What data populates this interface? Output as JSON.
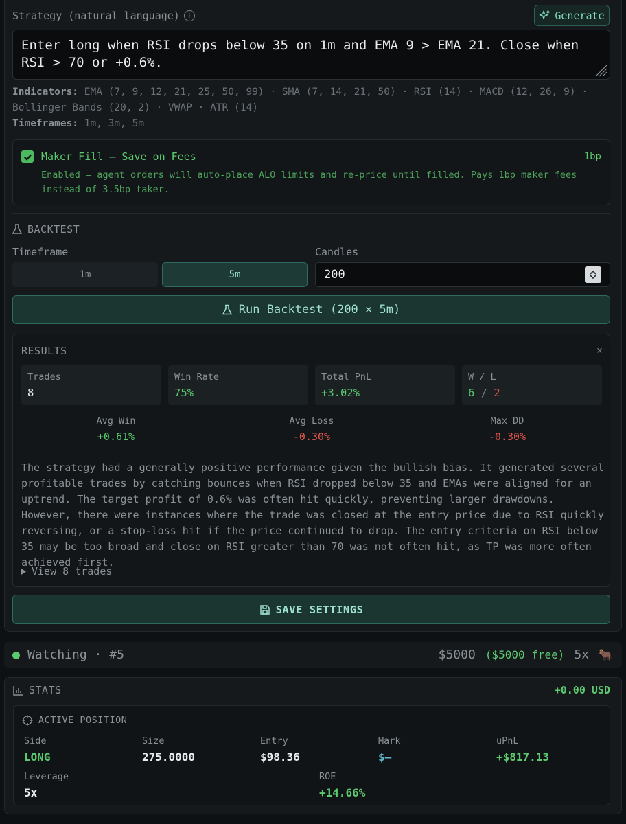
{
  "strategy": {
    "label": "Strategy (natural language)",
    "generate_label": "Generate",
    "text": "Enter long when RSI drops below 35 on 1m and EMA 9 > EMA 21. Close when RSI > 70 or +0.6%."
  },
  "indicators": {
    "label": "Indicators:",
    "line1": "EMA (7, 9, 12, 21, 25, 50, 99) · SMA (7, 14, 21, 50) · RSI (14) · MACD (12, 26, 9) ·",
    "line2": "Bollinger Bands (20, 2) · VWAP · ATR (14)",
    "timeframes_label": "Timeframes:",
    "timeframes": "1m, 3m, 5m"
  },
  "maker_fill": {
    "checked": true,
    "title": "Maker Fill — Save on Fees",
    "badge": "1bp",
    "description": "Enabled — agent orders will auto-place ALO limits and re-price until filled. Pays 1bp maker fees instead of 3.5bp taker."
  },
  "backtest": {
    "title": "BACKTEST",
    "timeframe_label": "Timeframe",
    "timeframe_options": [
      "1m",
      "5m"
    ],
    "selected_timeframe": "5m",
    "candles_label": "Candles",
    "candles_value": "200",
    "run_label": "Run Backtest (200 × 5m)"
  },
  "results": {
    "title": "RESULTS",
    "close": "×",
    "cards": [
      {
        "label": "Trades",
        "value": "8"
      },
      {
        "label": "Win Rate",
        "value": "75%"
      },
      {
        "label": "Total PnL",
        "value": "+3.02%"
      },
      {
        "label": "W / L",
        "wins": "6",
        "sep": "/",
        "losses": "2"
      }
    ],
    "avg_win_label": "Avg Win",
    "avg_win": "+0.61%",
    "avg_loss_label": "Avg Loss",
    "avg_loss": "-0.30%",
    "max_dd_label": "Max DD",
    "max_dd": "-0.30%",
    "analysis": "The strategy had a generally positive performance given the bullish bias. It generated several profitable trades by catching bounces when RSI dropped below 35 and EMAs were aligned for an uptrend. The target profit of 0.6% was often hit quickly, preventing larger drawdowns. However, there were instances where the trade was closed at the entry price due to RSI quickly reversing, or a stop-loss hit if the price continued to drop. The entry criteria on RSI below 35 may be too broad and close on RSI greater than 70 was not often hit, as TP was more often achieved first.",
    "view_trades": "View 8 trades"
  },
  "save_label": "SAVE SETTINGS",
  "watch": {
    "status": "Watching",
    "id": "#5",
    "balance": "$5000",
    "free": "($5000 free)",
    "leverage": "5x",
    "mascot": "🐂"
  },
  "stats": {
    "title": "STATS",
    "pnl_usd": "+0.00 USD",
    "active_position_title": "ACTIVE POSITION",
    "side_label": "Side",
    "side": "LONG",
    "size_label": "Size",
    "size": "275.0000",
    "entry_label": "Entry",
    "entry": "$98.36",
    "mark_label": "Mark",
    "mark": "$—",
    "upnl_label": "uPnL",
    "upnl": "+$817.13",
    "leverage_label": "Leverage",
    "leverage": "5x",
    "roe_label": "ROE",
    "roe": "+14.66%"
  },
  "colors": {
    "accent_teal": "#2f6a60",
    "positive": "#5cc96f",
    "negative": "#e2574c",
    "background": "#0e1113"
  }
}
